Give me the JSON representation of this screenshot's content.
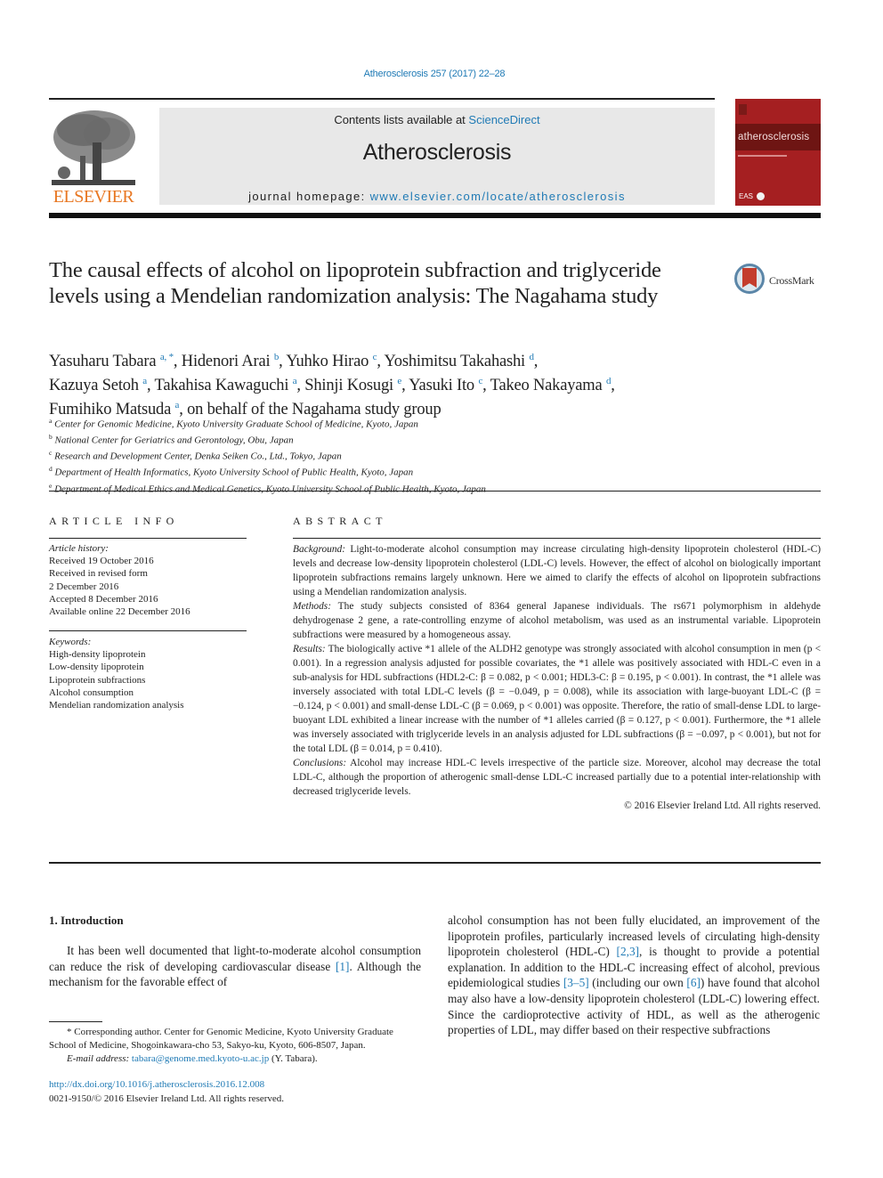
{
  "header": {
    "journal_ref": "Atherosclerosis 257 (2017) 22–28",
    "contents_prefix": "Contents lists available at ",
    "contents_link": "ScienceDirect",
    "journal_name": "Atherosclerosis",
    "homepage_prefix": "journal homepage: ",
    "homepage_link": "www.elsevier.com/locate/atherosclerosis",
    "publisher_logo": "ELSEVIER",
    "cover_title": "atherosclerosis",
    "cover_badge": "EAS"
  },
  "article": {
    "title": "The causal effects of alcohol on lipoprotein subfraction and triglyceride levels using a Mendelian randomization analysis: The Nagahama study",
    "crossmark_label": "CrossMark",
    "authors": [
      {
        "name": "Yasuharu Tabara",
        "sup": "a, *",
        "sep": ", "
      },
      {
        "name": "Hidenori Arai",
        "sup": "b",
        "sep": ", "
      },
      {
        "name": "Yuhko Hirao",
        "sup": "c",
        "sep": ", "
      },
      {
        "name": "Yoshimitsu Takahashi",
        "sup": "d",
        "sep": ","
      },
      {
        "name": "Kazuya Setoh",
        "sup": "a",
        "sep": ", "
      },
      {
        "name": "Takahisa Kawaguchi",
        "sup": "a",
        "sep": ", "
      },
      {
        "name": "Shinji Kosugi",
        "sup": "e",
        "sep": ", "
      },
      {
        "name": "Yasuki Ito",
        "sup": "c",
        "sep": ", "
      },
      {
        "name": "Takeo Nakayama",
        "sup": "d",
        "sep": ","
      },
      {
        "name": "Fumihiko Matsuda",
        "sup": "a",
        "sep": ", on behalf of the Nagahama study group"
      }
    ],
    "affiliations": [
      {
        "sup": "a",
        "text": "Center for Genomic Medicine, Kyoto University Graduate School of Medicine, Kyoto, Japan"
      },
      {
        "sup": "b",
        "text": "National Center for Geriatrics and Gerontology, Obu, Japan"
      },
      {
        "sup": "c",
        "text": "Research and Development Center, Denka Seiken Co., Ltd., Tokyo, Japan"
      },
      {
        "sup": "d",
        "text": "Department of Health Informatics, Kyoto University School of Public Health, Kyoto, Japan"
      },
      {
        "sup": "e",
        "text": "Department of Medical Ethics and Medical Genetics, Kyoto University School of Public Health, Kyoto, Japan"
      }
    ]
  },
  "article_info": {
    "heading": "ARTICLE INFO",
    "history_label": "Article history:",
    "history": [
      "Received 19 October 2016",
      "Received in revised form",
      "2 December 2016",
      "Accepted 8 December 2016",
      "Available online 22 December 2016"
    ],
    "keywords_label": "Keywords:",
    "keywords": [
      "High-density lipoprotein",
      "Low-density lipoprotein",
      "Lipoprotein subfractions",
      "Alcohol consumption",
      "Mendelian randomization analysis"
    ]
  },
  "abstract": {
    "heading": "ABSTRACT",
    "sections": [
      {
        "label": "Background:",
        "text": " Light-to-moderate alcohol consumption may increase circulating high-density lipoprotein cholesterol (HDL-C) levels and decrease low-density lipoprotein cholesterol (LDL-C) levels. However, the effect of alcohol on biologically important lipoprotein subfractions remains largely unknown. Here we aimed to clarify the effects of alcohol on lipoprotein subfractions using a Mendelian randomization analysis."
      },
      {
        "label": "Methods:",
        "text": " The study subjects consisted of 8364 general Japanese individuals. The rs671 polymorphism in aldehyde dehydrogenase 2 gene, a rate-controlling enzyme of alcohol metabolism, was used as an instrumental variable. Lipoprotein subfractions were measured by a homogeneous assay."
      },
      {
        "label": "Results:",
        "text": " The biologically active *1 allele of the ALDH2 genotype was strongly associated with alcohol consumption in men (p < 0.001). In a regression analysis adjusted for possible covariates, the *1 allele was positively associated with HDL-C even in a sub-analysis for HDL subfractions (HDL2-C: β = 0.082, p < 0.001; HDL3-C: β = 0.195, p < 0.001). In contrast, the *1 allele was inversely associated with total LDL-C levels (β = −0.049, p = 0.008), while its association with large-buoyant LDL-C (β = −0.124, p < 0.001) and small-dense LDL-C (β = 0.069, p < 0.001) was opposite. Therefore, the ratio of small-dense LDL to large-buoyant LDL exhibited a linear increase with the number of *1 alleles carried (β = 0.127, p < 0.001). Furthermore, the *1 allele was inversely associated with triglyceride levels in an analysis adjusted for LDL subfractions (β = −0.097, p < 0.001), but not for the total LDL (β = 0.014, p = 0.410)."
      },
      {
        "label": "Conclusions:",
        "text": " Alcohol may increase HDL-C levels irrespective of the particle size. Moreover, alcohol may decrease the total LDL-C, although the proportion of atherogenic small-dense LDL-C increased partially due to a potential inter-relationship with decreased triglyceride levels."
      }
    ],
    "copyright": "© 2016 Elsevier Ireland Ltd. All rights reserved."
  },
  "introduction": {
    "heading": "1.  Introduction",
    "col1": [
      {
        "t": "It has been well documented that light-to-moderate alcohol consumption can reduce the risk of developing cardiovascular disease "
      },
      {
        "t": "[1]",
        "link": true
      },
      {
        "t": ". Although the mechanism for the favorable effect of"
      }
    ],
    "col2": [
      {
        "t": "alcohol consumption has not been fully elucidated, an improvement of the lipoprotein profiles, particularly increased levels of circulating high-density lipoprotein cholesterol (HDL-C) "
      },
      {
        "t": "[2,3]",
        "link": true
      },
      {
        "t": ", is thought to provide a potential explanation. In addition to the HDL-C increasing effect of alcohol, previous epidemiological studies "
      },
      {
        "t": "[3–5]",
        "link": true
      },
      {
        "t": " (including our own "
      },
      {
        "t": "[6]",
        "link": true
      },
      {
        "t": ") have found that alcohol may also have a low-density lipoprotein cholesterol (LDL-C) lowering effect. Since the cardioprotective activity of HDL, as well as the atherogenic properties of LDL, may differ based on their respective subfractions"
      }
    ]
  },
  "footnote": {
    "corresponding": "* Corresponding author. Center for Genomic Medicine, Kyoto University Graduate School of Medicine, Shogoinkawara-cho 53, Sakyo-ku, Kyoto, 606-8507, Japan.",
    "email_label": "E-mail address: ",
    "email": "tabara@genome.med.kyoto-u.ac.jp",
    "email_suffix": " (Y. Tabara).",
    "doi": "http://dx.doi.org/10.1016/j.atherosclerosis.2016.12.008",
    "issn": "0021-9150/© 2016 Elsevier Ireland Ltd. All rights reserved."
  }
}
